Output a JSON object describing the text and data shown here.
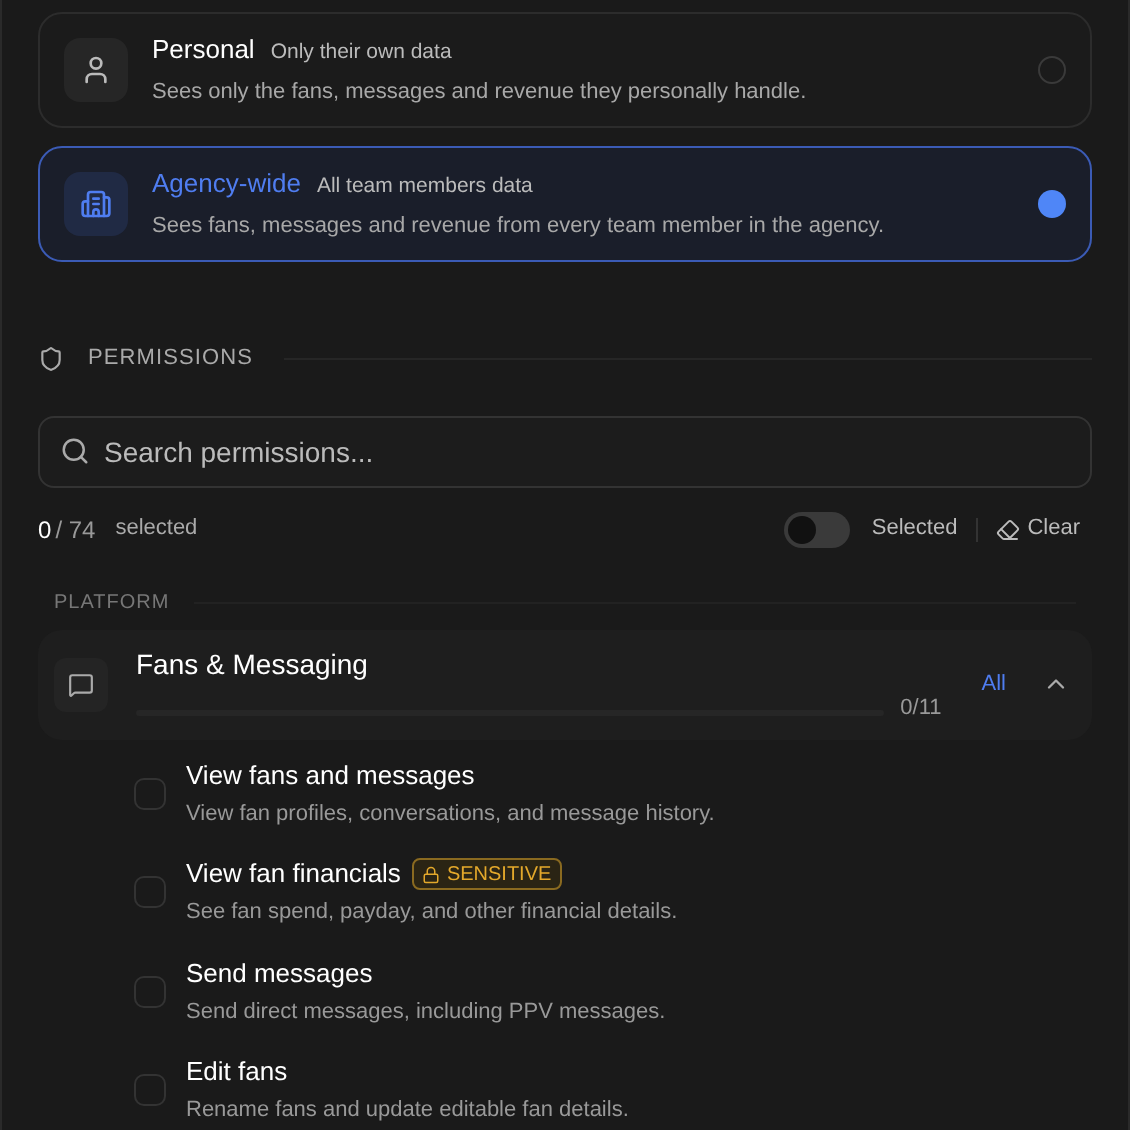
{
  "scopes": [
    {
      "kind": "personal",
      "title": "Personal",
      "subtitle": "Only their own data",
      "description": "Sees only the fans, messages and revenue they personally handle.",
      "selected": false
    },
    {
      "kind": "agency",
      "title": "Agency-wide",
      "subtitle": "All team members data",
      "description": "Sees fans, messages and revenue from every team member in the agency.",
      "selected": true
    }
  ],
  "permissions_heading": "PERMISSIONS",
  "search": {
    "placeholder": "Search permissions..."
  },
  "count": {
    "selected": "0",
    "total": "/ 74",
    "label": "selected"
  },
  "selected_filter": {
    "label": "Selected",
    "on": false
  },
  "clear_label": "Clear",
  "category": "PLATFORM",
  "group": {
    "title": "Fans & Messaging",
    "level": 0,
    "count": "0/11",
    "all_label": "All",
    "expanded": true,
    "items": [
      {
        "title": "View fans and messages",
        "description": "View fan profiles, conversations, and message history.",
        "checked": false,
        "sensitive": false
      },
      {
        "title": "View fan financials",
        "description": "See fan spend, payday, and other financial details.",
        "checked": false,
        "sensitive": true,
        "badge": "SENSITIVE"
      },
      {
        "title": "Send messages",
        "description": "Send direct messages, including PPV messages.",
        "checked": false,
        "sensitive": false
      },
      {
        "title": "Edit fans",
        "description": "Rename fans and update editable fan details.",
        "checked": false,
        "sensitive": false
      }
    ]
  }
}
